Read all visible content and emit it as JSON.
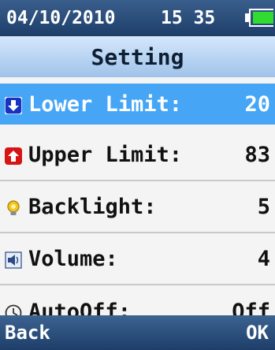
{
  "status": {
    "date": "04/10/2010",
    "time": "15 35",
    "battery_icon": "battery-icon"
  },
  "title": "Setting",
  "menu": [
    {
      "icon": "down-arrow-icon",
      "label": "Lower Limit:",
      "value": "20",
      "selected": true
    },
    {
      "icon": "up-arrow-icon",
      "label": "Upper Limit:",
      "value": "83",
      "selected": false
    },
    {
      "icon": "lightbulb-icon",
      "label": "Backlight:",
      "value": "5",
      "selected": false
    },
    {
      "icon": "speaker-icon",
      "label": "Volume:",
      "value": "4",
      "selected": false
    },
    {
      "icon": "clock-icon",
      "label": "AutoOff:",
      "value": "Off",
      "selected": false
    }
  ],
  "softkeys": {
    "left": "Back",
    "right": "OK"
  },
  "colors": {
    "header": "#1d3e69",
    "title": "#9fc2ea",
    "selection": "#46a6f5",
    "battery": "#2fdc2f"
  }
}
